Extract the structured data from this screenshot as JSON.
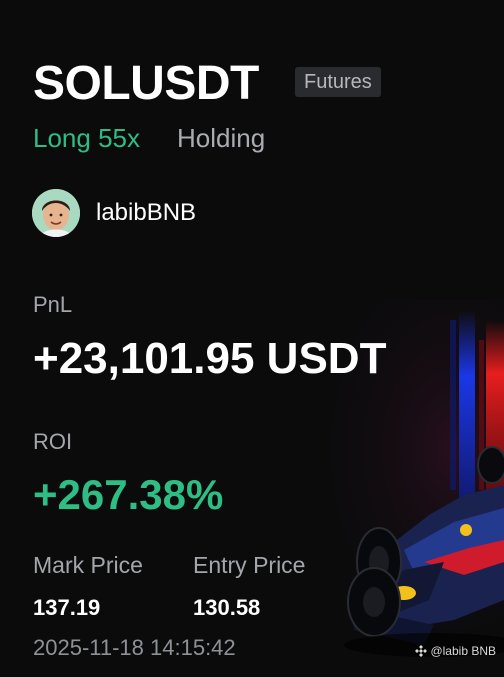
{
  "position": {
    "symbol": "SOLUSDT",
    "market_badge": "Futures",
    "side_leverage": "Long 55x",
    "status": "Holding"
  },
  "user": {
    "name": "labibBNB",
    "avatar_icon": "avatar-photo"
  },
  "pnl": {
    "label": "PnL",
    "value": "+23,101.95 USDT"
  },
  "roi": {
    "label": "ROI",
    "value": "+267.38%"
  },
  "prices": {
    "mark_label": "Mark Price",
    "mark_value": "137.19",
    "entry_label": "Entry Price",
    "entry_value": "130.58"
  },
  "timestamp": "2025-11-18 14:15:42",
  "watermark": {
    "icon": "binance-logo-icon",
    "text": "@labib BNB"
  },
  "colors": {
    "background": "#0b0b0c",
    "positive": "#2ebd85",
    "muted": "#a3a6ab",
    "badge_bg": "#2a2b2e"
  }
}
